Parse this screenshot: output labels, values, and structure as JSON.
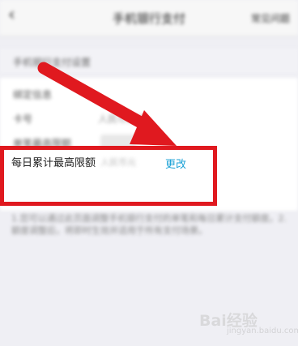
{
  "nav": {
    "back_icon": "chevron-left-icon",
    "back_glyph": "‹",
    "title": "手机银行支付",
    "help_label": "常见问题"
  },
  "section": {
    "header": "手机银行支付设置"
  },
  "rows": [
    {
      "label": "绑定信息",
      "value": ""
    },
    {
      "label": "卡号",
      "value": "人民币账户"
    },
    {
      "label": "单笔最高限额",
      "value": ""
    }
  ],
  "limit_row": {
    "label": "每日累计最高限额",
    "value": "人民币元",
    "change_label": "更改"
  },
  "notes": "1.您可以通过此页面调整手机银行支付的单笔和每日累计支付额度。2.额度调整后，将即时生效并适用于所有支付场景。",
  "watermark": {
    "text": "Bai经验",
    "sub": "jingyan.baidu.com"
  },
  "colors": {
    "highlight_red": "#e0191f",
    "link_blue": "#1aa1d6"
  }
}
